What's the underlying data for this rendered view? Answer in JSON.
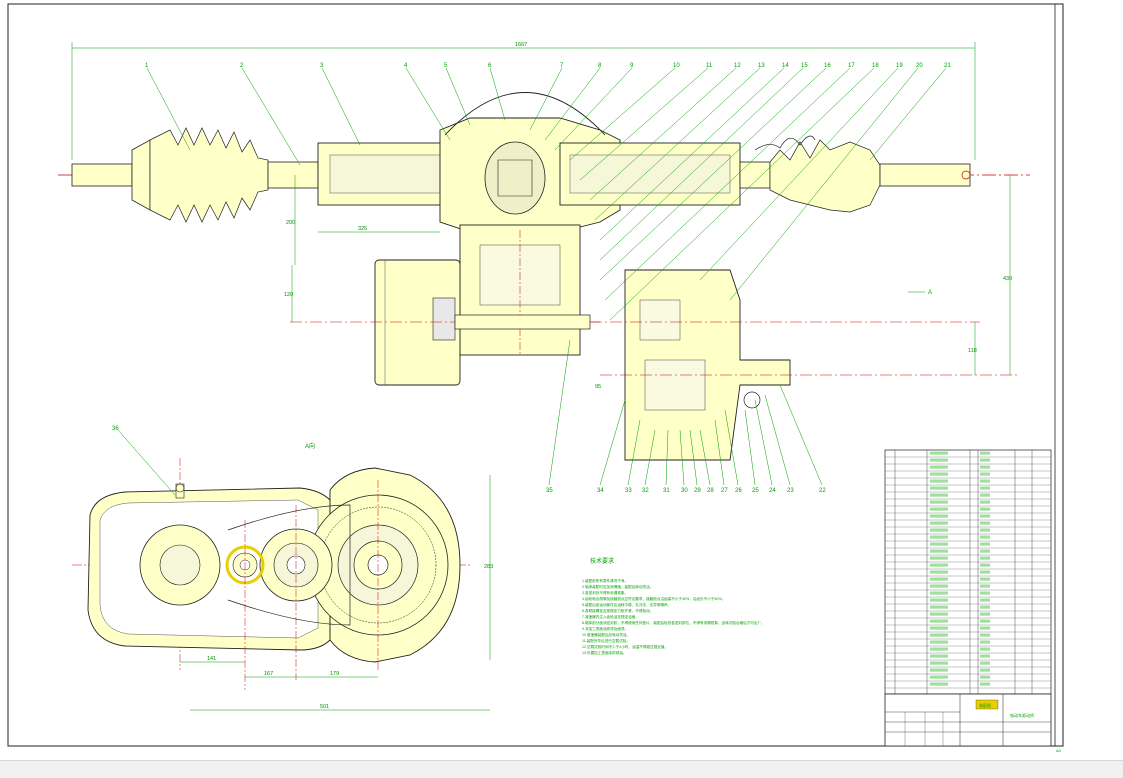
{
  "drawing": {
    "dimensions": {
      "overall_width": "1667",
      "left_shaft_offset": "325",
      "vertical_left": "200",
      "vertical_motor": "120",
      "right_height": "430",
      "right_lower": "118",
      "mid_small": "95",
      "gearbox_height": "283",
      "base_a": "141",
      "base_b": "167",
      "base_c": "179",
      "base_total": "501",
      "inner_box": "130"
    },
    "view_labels": {
      "section_a": "A向",
      "arrow_a": "A",
      "tech_req_title": "技术要求"
    },
    "top_callouts": [
      "1",
      "2",
      "3",
      "4",
      "5",
      "6",
      "7",
      "8",
      "9",
      "10",
      "11",
      "12",
      "13",
      "14",
      "15",
      "16",
      "17",
      "18",
      "19",
      "20",
      "21"
    ],
    "bottom_callouts": [
      "35",
      "34",
      "33",
      "32",
      "31",
      "30",
      "29",
      "28",
      "27",
      "26",
      "25",
      "24",
      "23",
      "22"
    ],
    "side_callout": "36",
    "notes": [
      "1.装配前所有零件清洗干净。",
      "2.轴承装配时应加润滑脂，装配后转动灵活。",
      "3.各密封处不得有渗漏现象。",
      "4.齿轮啮合侧隙及接触斑点应符合要求，接触斑点沿齿高不小于40%，沿齿长不小于50%。",
      "5.装配后各运动部件应运转平稳，无冲击、无异常噪声。",
      "6.各联接螺栓应按规定力矩拧紧，不得松动。",
      "7.减速器内注入齿轮油至规定油面。",
      "8.箱体剖分面涂密封胶，不得使用任何垫片，装配后检查各密封部位，不得有渗漏现象，运转试验合格后方可出厂。",
      "9.非加工表面涂底漆及面漆。",
      "10.差速器装配后应转动灵活。",
      "11.装配完毕后进行空载试验。",
      "12.空载试验时间不少于2小时，油温不得超过规定值。",
      "13.外露加工表面涂防锈油。"
    ],
    "title_block": {
      "drawing_name": "电动车驱动桥",
      "stamp": "装配图",
      "sheet": "A0"
    }
  }
}
